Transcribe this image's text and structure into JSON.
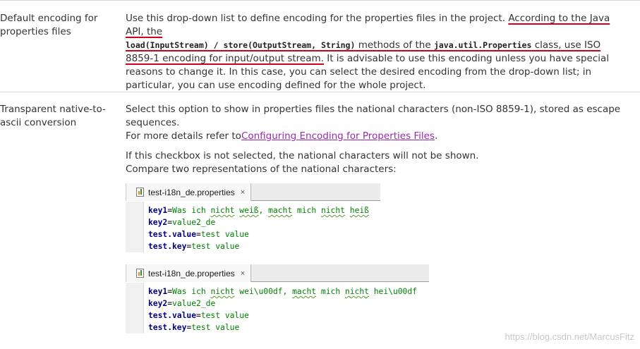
{
  "row1": {
    "label": "Default encoding for properties files",
    "text_a": "Use this drop-down list to define encoding for the properties files in the project. ",
    "text_b": "According to the Java API, the",
    "code_1": "load(InputStream) / store(OutputStream, String)",
    "text_c": " methods of the ",
    "code_2": "java.util.Properties",
    "text_d": " class, use ISO",
    "text_e": "8859-1 encoding for input/output stream.",
    "text_f": " It is advisable to use this encoding unless you have special reasons to change it. In this case, you can select the desired encoding from the drop-down list; in particular, you can use encoding defined for the whole project."
  },
  "row2": {
    "label": "Transparent native-to-ascii conversion",
    "text_a": "Select this option to show in properties files the national characters (non-ISO 8859-1), stored as escape sequences.",
    "text_b": "For more details refer to",
    "link": "Configuring Encoding for Properties Files",
    "text_c": ".",
    "text_d": "If this checkbox is not selected, the national characters will not be shown.",
    "text_e": "Compare two representations of the national characters:"
  },
  "editor1": {
    "tab_label": "test-i18n_de.properties",
    "close": "×",
    "lines": [
      {
        "key": "key1",
        "eq": "=",
        "parts": [
          [
            "Was ich ",
            ""
          ],
          [
            "nicht",
            "w"
          ],
          [
            " ",
            ""
          ],
          [
            "weiß",
            "w"
          ],
          [
            ", ",
            ""
          ],
          [
            "macht",
            "w"
          ],
          [
            " mich ",
            ""
          ],
          [
            "nicht",
            "w"
          ],
          [
            " ",
            ""
          ],
          [
            "heiß",
            "w"
          ]
        ]
      },
      {
        "key": "key2",
        "eq": "=",
        "parts": [
          [
            "value2_de",
            ""
          ]
        ]
      },
      {
        "key": "test.value",
        "eq": "=",
        "parts": [
          [
            "test value",
            ""
          ]
        ]
      },
      {
        "key": "test.key",
        "eq": "=",
        "parts": [
          [
            "test value",
            ""
          ]
        ]
      }
    ]
  },
  "editor2": {
    "tab_label": "test-i18n_de.properties",
    "close": "×",
    "lines": [
      {
        "key": "key1",
        "eq": "=",
        "parts": [
          [
            "Was ich ",
            ""
          ],
          [
            "nicht",
            "w"
          ],
          [
            " wei\\u00df, ",
            ""
          ],
          [
            "macht",
            "w"
          ],
          [
            " mich ",
            ""
          ],
          [
            "nicht",
            "w"
          ],
          [
            " hei\\u00df",
            ""
          ]
        ]
      },
      {
        "key": "key2",
        "eq": "=",
        "parts": [
          [
            "value2_de",
            ""
          ]
        ]
      },
      {
        "key": "test.value",
        "eq": "=",
        "parts": [
          [
            "test value",
            ""
          ]
        ]
      },
      {
        "key": "test.key",
        "eq": "=",
        "parts": [
          [
            "test value",
            ""
          ]
        ]
      }
    ]
  },
  "watermark": "https://blog.csdn.net/MarcusFitz",
  "colors": {
    "key": "#000080",
    "value": "#008000",
    "link": "#9c27b0",
    "annotation": "#d0021b"
  },
  "icons": {
    "file": "properties-file-icon",
    "close": "close-icon"
  }
}
